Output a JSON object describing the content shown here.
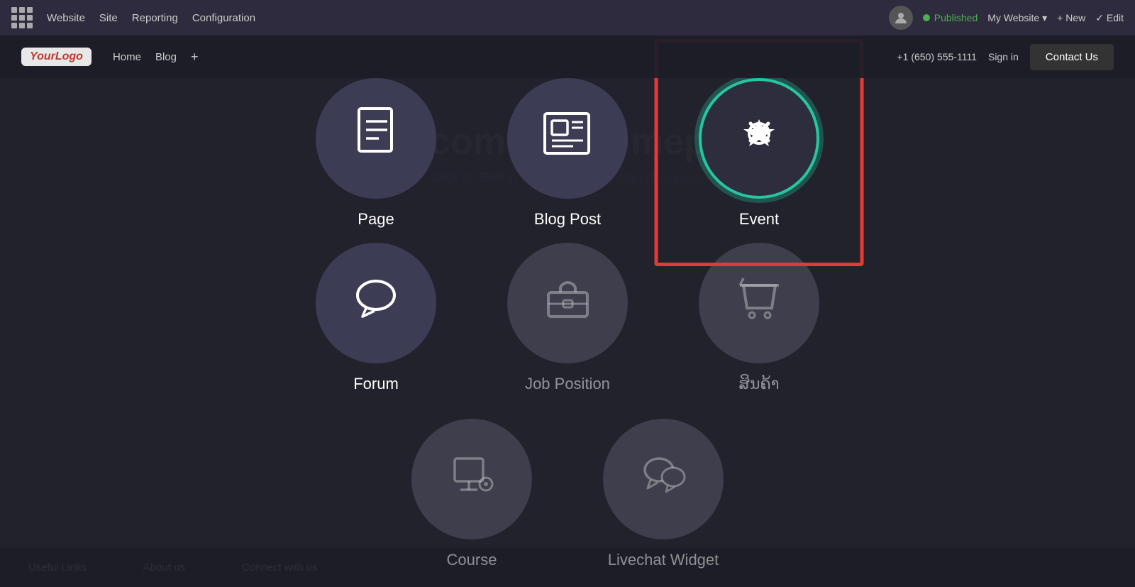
{
  "topnav": {
    "website_label": "Website",
    "site_label": "Site",
    "reporting_label": "Reporting",
    "configuration_label": "Configuration",
    "published_label": "Published",
    "my_website_label": "My Website",
    "new_label": "+ New",
    "edit_label": "✓ Edit"
  },
  "sitenav": {
    "logo_your": "Your",
    "logo_logo": "Logo",
    "home_label": "Home",
    "blog_label": "Blog",
    "plus_label": "+",
    "phone_label": "+1 (650) 555-1111",
    "signin_label": "Sign in",
    "contact_us_label": "Contact Us"
  },
  "hero": {
    "title": "Welcome to Homepage",
    "subtitle_part1": "Click on ",
    "subtitle_edit": "Edit",
    "subtitle_part2": " in the top corner to start designing."
  },
  "options": [
    {
      "id": "page",
      "icon": "📄",
      "label": "Page",
      "style": "normal"
    },
    {
      "id": "blog-post",
      "icon": "📰",
      "label": "Blog Post",
      "style": "normal"
    },
    {
      "id": "event",
      "icon": "🏷",
      "label": "Event",
      "style": "highlighted"
    },
    {
      "id": "forum",
      "icon": "💬",
      "label": "Forum",
      "style": "normal"
    },
    {
      "id": "job-position",
      "icon": "💼",
      "label": "Job Position",
      "style": "dimmed"
    },
    {
      "id": "shop",
      "icon": "🛒",
      "label": "ສິນຄ້າ",
      "style": "dimmed"
    },
    {
      "id": "course",
      "icon": "📊",
      "label": "Course",
      "style": "dimmed"
    },
    {
      "id": "livechat",
      "icon": "💬",
      "label": "Livechat Widget",
      "style": "dimmed"
    }
  ],
  "footer": {
    "useful_links": "Useful Links",
    "about_us": "About us",
    "connect": "Connect with us"
  },
  "highlight": {
    "color": "#e53935"
  }
}
